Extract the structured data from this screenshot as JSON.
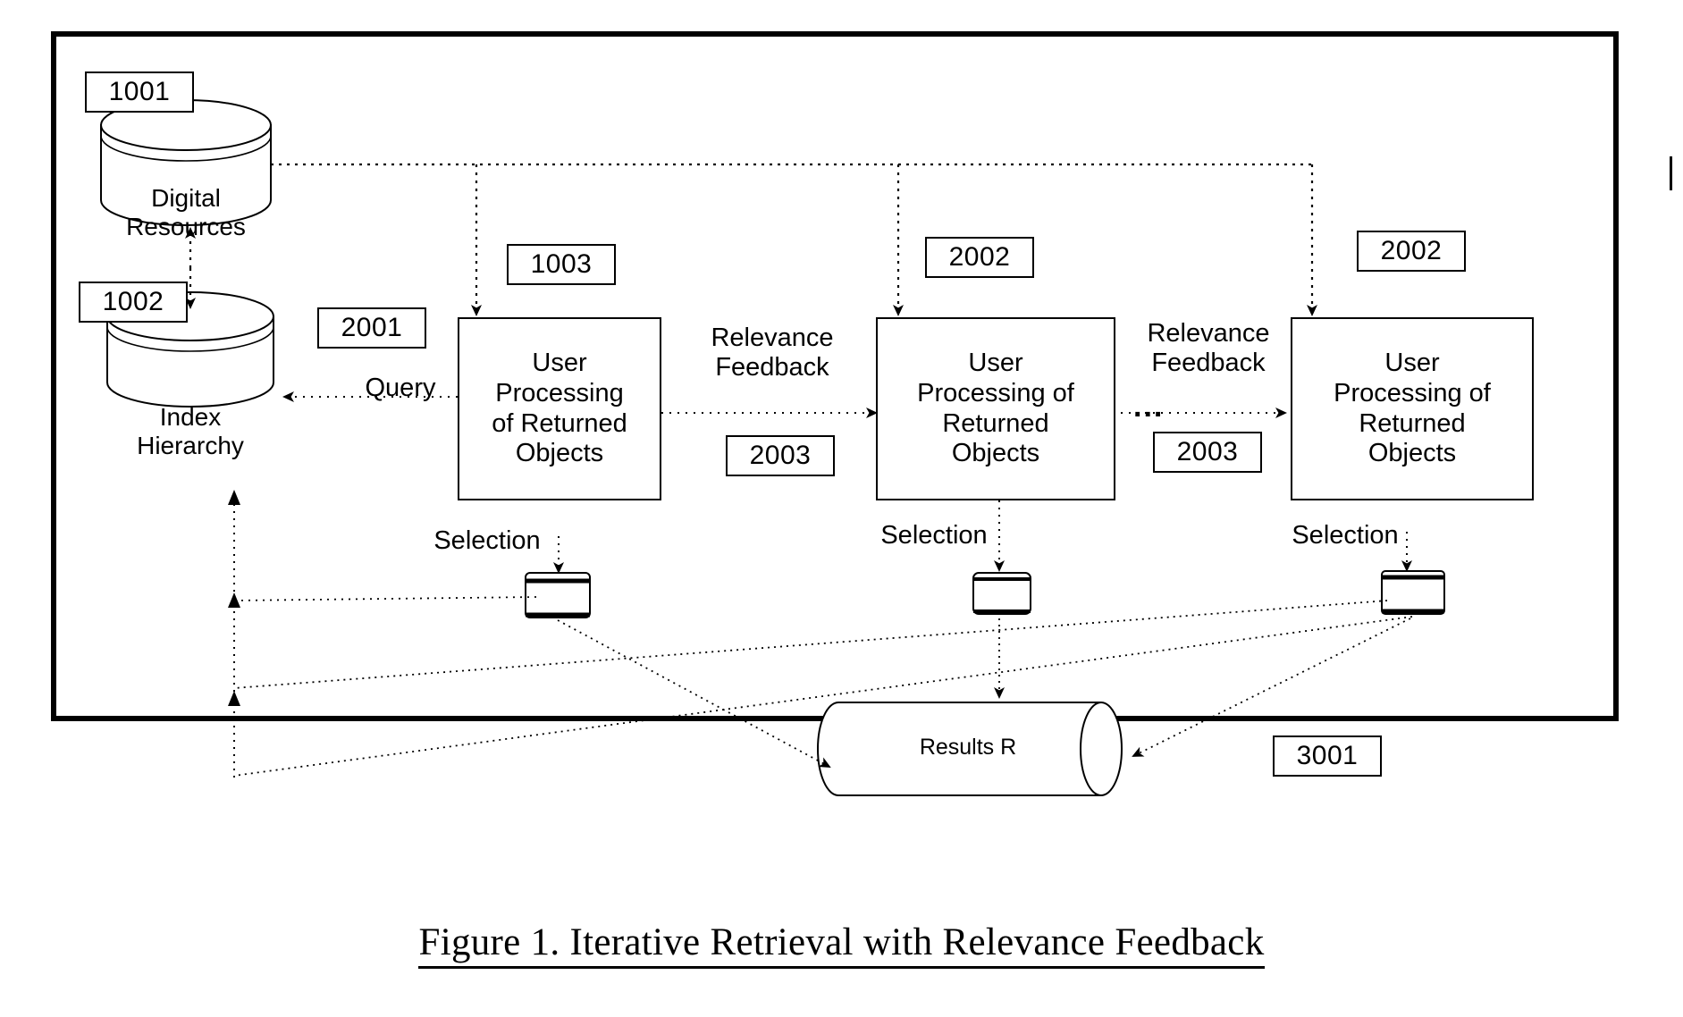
{
  "figure": {
    "caption": "Figure 1. Iterative Retrieval with Relevance Feedback"
  },
  "ref_tags": [
    {
      "id": "ref-1001",
      "label": "1001"
    },
    {
      "id": "ref-1002",
      "label": "1002"
    },
    {
      "id": "ref-2001",
      "label": "2001"
    },
    {
      "id": "ref-1003",
      "label": "1003"
    },
    {
      "id": "ref-2002-a",
      "label": "2002"
    },
    {
      "id": "ref-2002-b",
      "label": "2002"
    },
    {
      "id": "ref-2003-a",
      "label": "2003"
    },
    {
      "id": "ref-2003-b",
      "label": "2003"
    },
    {
      "id": "ref-3001",
      "label": "3001"
    }
  ],
  "stores": {
    "digital_resources": "Digital\nResources",
    "index_hierarchy": "Index\nHierarchy",
    "results": "Results R"
  },
  "process_boxes": [
    {
      "id": "process-1",
      "label": "User\nProcessing\nof Returned\nObjects"
    },
    {
      "id": "process-2",
      "label": "User\nProcessing of\nReturned\nObjects"
    },
    {
      "id": "process-3",
      "label": "User\nProcessing of\nReturned\nObjects"
    }
  ],
  "edge_labels": {
    "query": "Query",
    "relevance_feedback_1": "Relevance\nFeedback",
    "relevance_feedback_2": "Relevance\nFeedback",
    "ellipsis": "...",
    "selection_1": "Selection",
    "selection_2": "Selection",
    "selection_3": "Selection"
  },
  "colors": {
    "stroke": "#000000",
    "background": "#ffffff"
  }
}
